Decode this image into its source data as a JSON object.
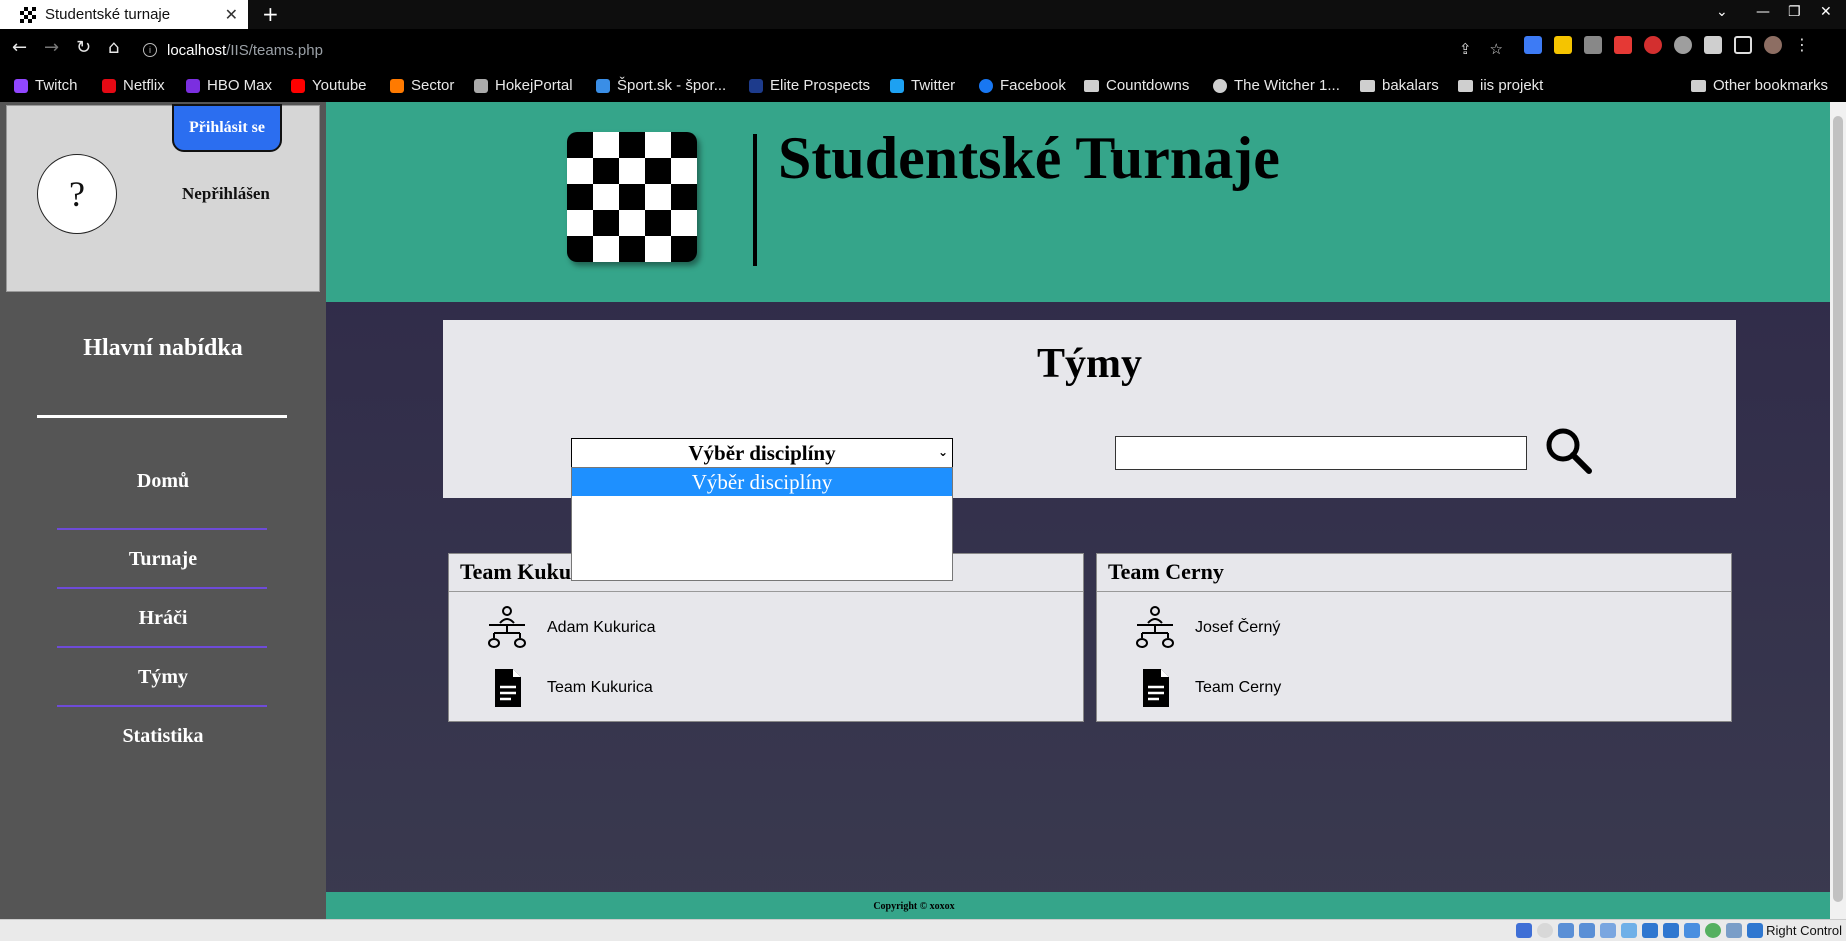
{
  "browser": {
    "tab_title": "Studentské turnaje",
    "url_host": "localhost",
    "url_path": "/IIS/teams.php",
    "bookmarks": [
      {
        "label": "Twitch",
        "icon": "twitch-icon",
        "color": "#9146ff"
      },
      {
        "label": "Netflix",
        "icon": "netflix-icon",
        "color": "#e50914"
      },
      {
        "label": "HBO Max",
        "icon": "hbomax-icon",
        "color": "#7b2fe0"
      },
      {
        "label": "Youtube",
        "icon": "youtube-icon",
        "color": "#ff0000"
      },
      {
        "label": "Sector",
        "icon": "sector-icon",
        "color": "#ff7a00"
      },
      {
        "label": "HokejPortal",
        "icon": "hokejportal-icon",
        "color": "#aaaaaa"
      },
      {
        "label": "Šport.sk - špor...",
        "icon": "sport-icon",
        "color": "#3a8ee6"
      },
      {
        "label": "Elite Prospects",
        "icon": "eliteprospects-icon",
        "color": "#1d3b8c"
      },
      {
        "label": "Twitter",
        "icon": "twitter-icon",
        "color": "#1da1f2"
      },
      {
        "label": "Facebook",
        "icon": "facebook-icon",
        "color": "#1877f2"
      },
      {
        "label": "Countdowns",
        "icon": "folder-icon",
        "color": "#cfcfcf"
      },
      {
        "label": "The Witcher 1...",
        "icon": "globe-icon",
        "color": "#cfcfcf"
      },
      {
        "label": "bakalars",
        "icon": "folder-icon",
        "color": "#cfcfcf"
      },
      {
        "label": "iis projekt",
        "icon": "folder-icon",
        "color": "#cfcfcf"
      }
    ],
    "other_bookmarks": "Other bookmarks"
  },
  "sidebar": {
    "login_button": "Přihlásit se",
    "avatar_char": "?",
    "login_status": "Nepřihlášen",
    "menu_title": "Hlavní nabídka",
    "menu_items": [
      "Domů",
      "Turnaje",
      "Hráči",
      "Týmy",
      "Statistika"
    ]
  },
  "header": {
    "site_title": "Studentské Turnaje"
  },
  "main": {
    "panel_title": "Týmy",
    "discipline_select": "Výběr disciplíny",
    "dropdown_options": [
      "Výběr disciplíny"
    ],
    "search_value": "",
    "teams": [
      {
        "name": "Team Kukurica",
        "leader": "Adam Kukurica",
        "team_name": "Team Kukurica"
      },
      {
        "name": "Team Cerny",
        "leader": "Josef Černý",
        "team_name": "Team Cerny"
      }
    ]
  },
  "footer": {
    "copyright": "Copyright © xoxox"
  },
  "taskbar": {
    "label": "Right Control"
  },
  "colors": {
    "header_green": "#35a58a",
    "sidebar_gray": "#555555",
    "login_blue": "#2b6ef0",
    "select_highlight": "#1e90ff",
    "menu_divider": "#6e4bd8"
  }
}
